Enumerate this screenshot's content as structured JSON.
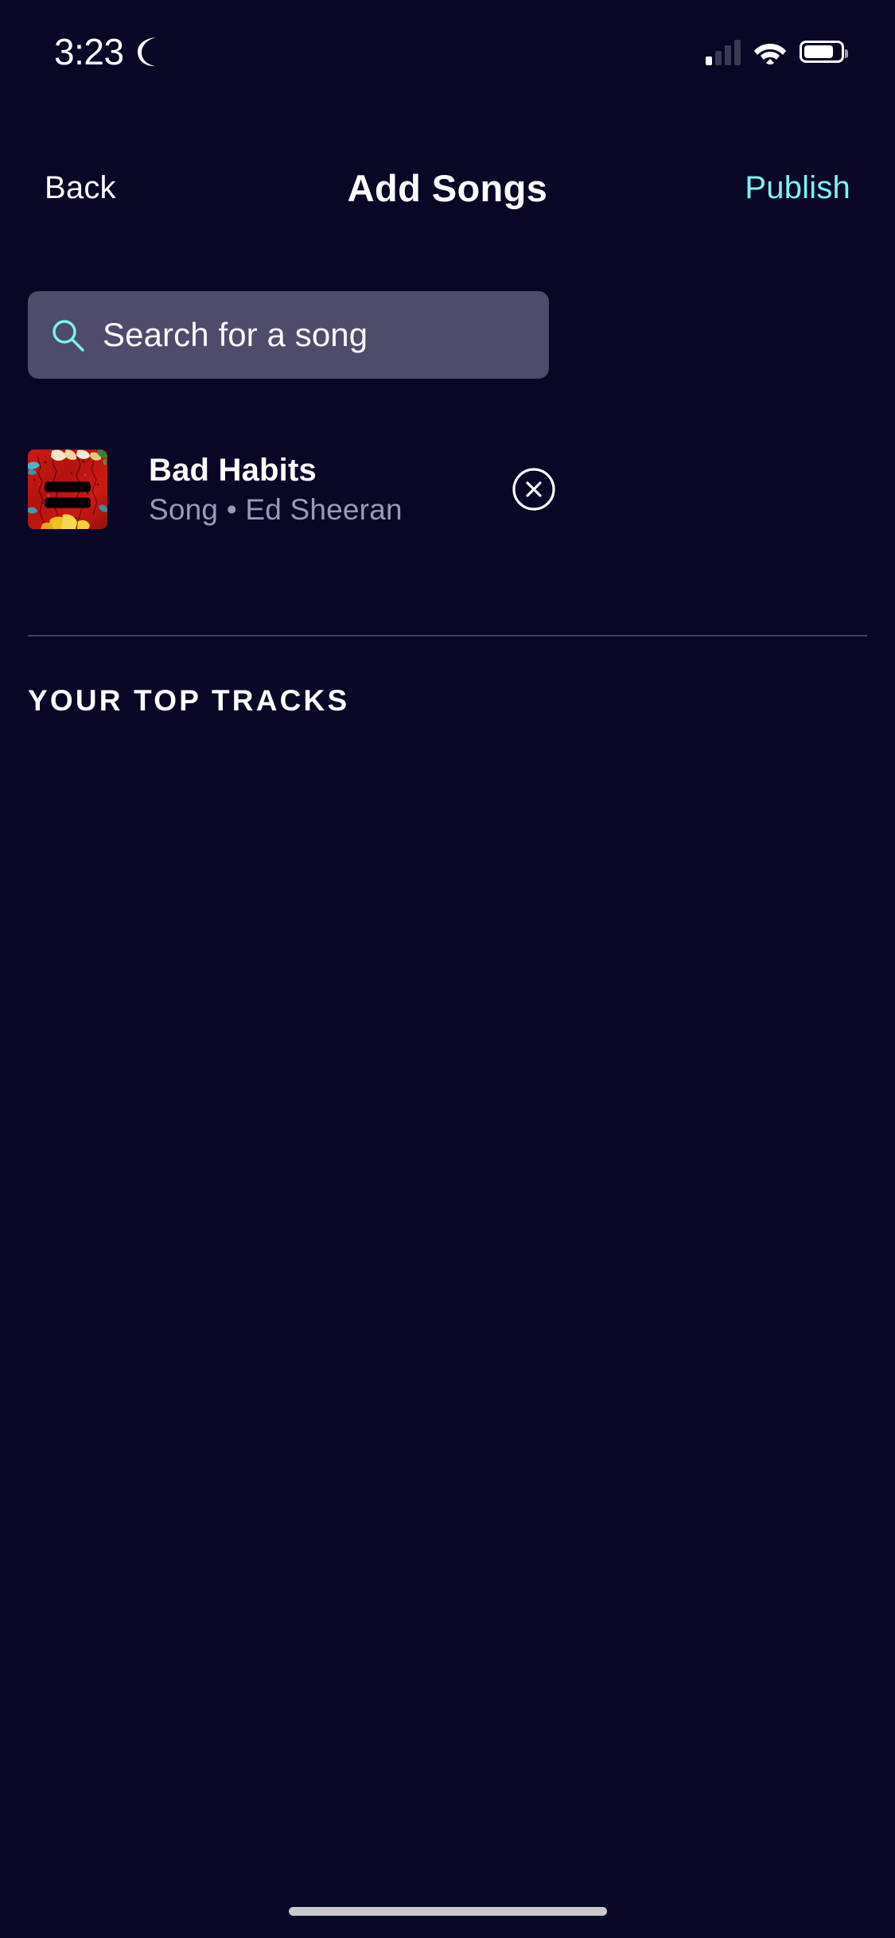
{
  "status_bar": {
    "time": "3:23",
    "dnd_icon": "moon-icon",
    "signal_icon": "cellular-signal-icon",
    "wifi_icon": "wifi-icon",
    "battery_icon": "battery-icon"
  },
  "nav": {
    "back_label": "Back",
    "title": "Add Songs",
    "publish_label": "Publish",
    "publish_color": "#7DF3F0"
  },
  "search": {
    "placeholder": "Search for a song",
    "value": "",
    "icon": "search-icon",
    "background_color": "#4E4C6B",
    "icon_color": "#7DF3F0"
  },
  "selected_songs": [
    {
      "title": "Bad Habits",
      "subtitle": "Song • Ed Sheeran",
      "type": "Song",
      "artist": "Ed Sheeran",
      "album_art": "equals-album-cover",
      "remove_icon": "close-circle-icon"
    }
  ],
  "section": {
    "top_tracks_label": "YOUR TOP TRACKS",
    "tracks": []
  },
  "theme": {
    "background": "#080726",
    "text_primary": "#FFFFFF",
    "text_secondary": "#9A9AB8",
    "accent": "#7DF3F0",
    "divider": "#43405F"
  },
  "home_indicator": "home-indicator"
}
